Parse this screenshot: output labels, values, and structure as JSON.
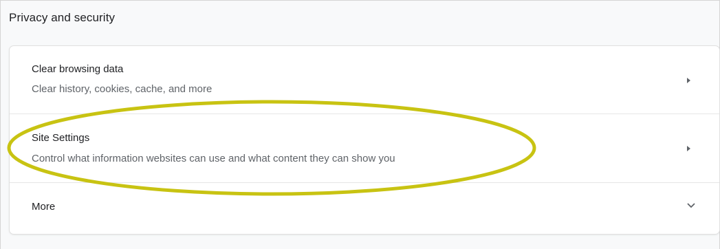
{
  "section": {
    "title": "Privacy and security"
  },
  "items": [
    {
      "title": "Clear browsing data",
      "subtitle": "Clear history, cookies, cache, and more",
      "icon": "chevron-right-icon"
    },
    {
      "title": "Site Settings",
      "subtitle": "Control what information websites can use and what content they can show you",
      "icon": "chevron-right-icon"
    },
    {
      "title": "More",
      "icon": "chevron-down-icon"
    }
  ],
  "colors": {
    "annotation": "#c8c312",
    "text_primary": "#202124",
    "text_secondary": "#5f6368"
  }
}
